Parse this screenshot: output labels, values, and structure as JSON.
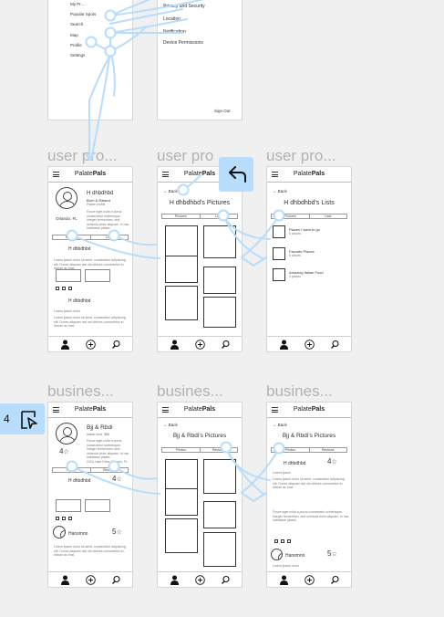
{
  "app_logo": {
    "prefix": "Palate",
    "suffix": "Pals"
  },
  "settings_left": {
    "items": [
      "My Pr...",
      "Popular Spots",
      "Search",
      "Map",
      "Profile",
      "Settings"
    ]
  },
  "settings_right": {
    "items": [
      "Privacy and Security",
      "Location",
      "Notification",
      "Device Permissions"
    ],
    "signout": "Sign Out"
  },
  "row_user": {
    "titles": [
      "user pro...",
      "user pro",
      "user pro..."
    ],
    "profile": {
      "name": "H dhbdhbd",
      "subtitle1": "Born & Raised",
      "subtitle2": "Palate profile",
      "location": "Orlando, FL",
      "bio": "Fusce eget nulla a purus consectetur scelerisque. Integer fermentum, and vehicula dolor aliquam. In hac habitasse platea.",
      "tab1": "Pictures",
      "tab2": "Lists",
      "review_name": "H dhbdhbd",
      "review_text": "Lorem ipsum dolor sit amet, consectetur adipiscing elit. Donec aliquam nisl vel ultrices consectetur et, dictum ac erat.",
      "review_name2": "H dhbdhbd",
      "review_label": "Lorem ipsum dolor"
    },
    "pictures": {
      "back": "Back",
      "title": "H dhbdhbd's Pictures",
      "tab1": "Pictures",
      "tab2": "Lists"
    },
    "lists": {
      "back": "Back",
      "title": "H dhbdhbd's Lists",
      "tab1": "Pictures",
      "tab2": "Lists",
      "items": [
        {
          "name": "Places I want to go",
          "count": "0 places"
        },
        {
          "name": "Favorite Places",
          "count": "0 places"
        },
        {
          "name": "Amazing Italian Food",
          "count": "0 places"
        }
      ]
    }
  },
  "row_business": {
    "titles": [
      "busines...",
      "busines...",
      "busines..."
    ],
    "profile": {
      "name": "Bjj & Rbdi",
      "subtitle": "Italian food, $$$",
      "rating": "4",
      "bio": "Fusce eget nulla a purus consectetur scelerisque. Integer fermentum, and vehicula dolor aliquam. In hac habitasse platea.",
      "address": "2424 Lake Drive Orlando, FL",
      "tab1": "Photos",
      "tab2": "Reviews",
      "review1_name": "H dhbdhbd",
      "review1_rating": "4",
      "review2_name": "Hansmno",
      "review2_rating": "5"
    },
    "pictures": {
      "back": "Back",
      "title": "Bjj & Rbdi's Pictures",
      "tab1": "Photos",
      "tab2": "Reviews"
    },
    "reviews": {
      "back": "Back",
      "title": "Bjj & Rbdi's Pictures",
      "tab1": "Photos",
      "tab2": "Reviews",
      "review1_name": "H dhbdhbd",
      "review1_rating": "4",
      "review1_label": "Lorem ipsum",
      "review2_name": "Hansmno",
      "review2_rating": "5"
    }
  },
  "toolbar": {
    "number_label": "4"
  },
  "colors": {
    "accent": "#b8dcfb",
    "connector": "#b8dcfb",
    "frame_title": "#b2b2b2",
    "canvas": "#f0f0f0"
  },
  "icons": [
    "hamburger-icon",
    "back-arrow-icon",
    "user-icon",
    "plus-circle-icon",
    "search-icon",
    "star-icon",
    "undo-arrow-icon",
    "play-frame-icon"
  ]
}
